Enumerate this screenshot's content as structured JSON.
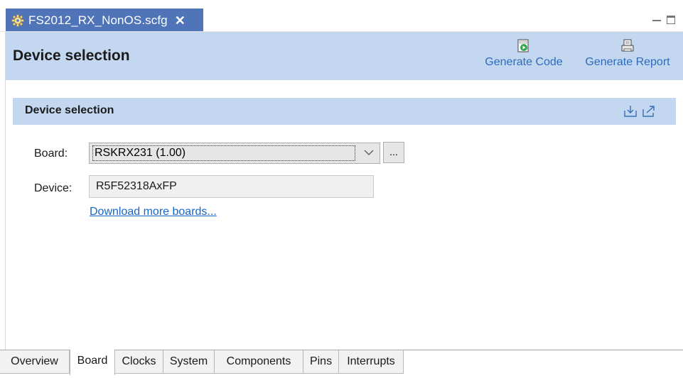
{
  "editor": {
    "tab_title": "FS2012_RX_NonOS.scfg",
    "close_glyph": "✕",
    "tab_color": "#4f74b8"
  },
  "header": {
    "title": "Device selection",
    "actions": [
      {
        "label": "Generate Code",
        "icon": "generate-code-icon"
      },
      {
        "label": "Generate Report",
        "icon": "generate-report-icon"
      }
    ],
    "background": "#c3d7f0",
    "link_color": "#2e6bbf"
  },
  "section": {
    "title": "Device selection",
    "icons": [
      "import-icon",
      "export-icon"
    ]
  },
  "form": {
    "board_label": "Board:",
    "board_value": "RSKRX231 (1.00)",
    "browse_label": "...",
    "device_label": "Device:",
    "device_value": "R5F52318AxFP",
    "download_link": "Download more boards..."
  },
  "bottom_tabs": [
    {
      "label": "Overview",
      "active": false
    },
    {
      "label": "Board",
      "active": true
    },
    {
      "label": "Clocks",
      "active": false
    },
    {
      "label": "System",
      "active": false
    },
    {
      "label": "Components",
      "active": false
    },
    {
      "label": "Pins",
      "active": false
    },
    {
      "label": "Interrupts",
      "active": false
    }
  ]
}
